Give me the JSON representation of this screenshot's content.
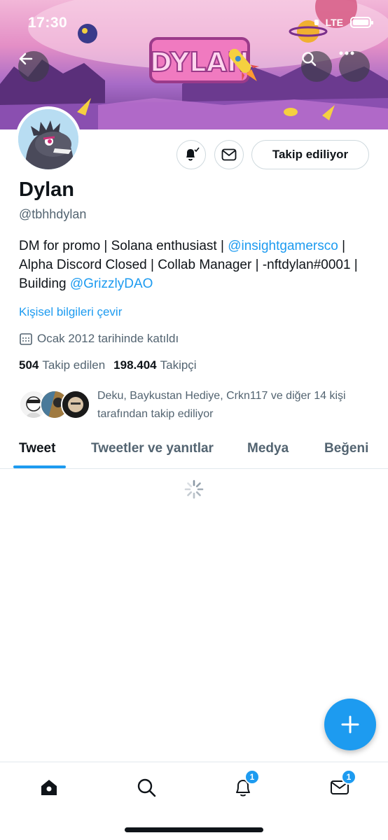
{
  "status_bar": {
    "time": "17:30",
    "network": "LTE"
  },
  "banner": {
    "art_text": "DYLAN"
  },
  "profile": {
    "name": "Dylan",
    "handle": "@tbhhdylan",
    "bio": {
      "part1": "DM for promo | Solana enthusiast | ",
      "mention1": "@insightgamersco",
      "part2": " | Alpha Discord Closed | Collab Manager | -nftdylan#0001 | Building ",
      "mention2": "@GrizzlyDAO"
    },
    "translate_label": "Kişisel bilgileri çevir",
    "joined": "Ocak 2012 tarihinde katıldı",
    "following_count": "504",
    "following_label": "Takip edilen",
    "followers_count": "198.404",
    "followers_label": "Takipçi",
    "followed_by": "Deku, Baykustan Hediye, Crkn117 ve diğer 14 kişi tarafından takip ediliyor"
  },
  "actions": {
    "follow_label": "Takip ediliyor"
  },
  "tabs": [
    {
      "label": "Tweet",
      "active": true
    },
    {
      "label": "Tweetler ve yanıtlar",
      "active": false
    },
    {
      "label": "Medya",
      "active": false
    },
    {
      "label": "Beğeni",
      "active": false
    }
  ],
  "bottom_nav": {
    "notifications_badge": "1",
    "messages_badge": "1"
  },
  "colors": {
    "accent": "#1d9bf0",
    "text": "#0f1419",
    "muted": "#536471"
  }
}
